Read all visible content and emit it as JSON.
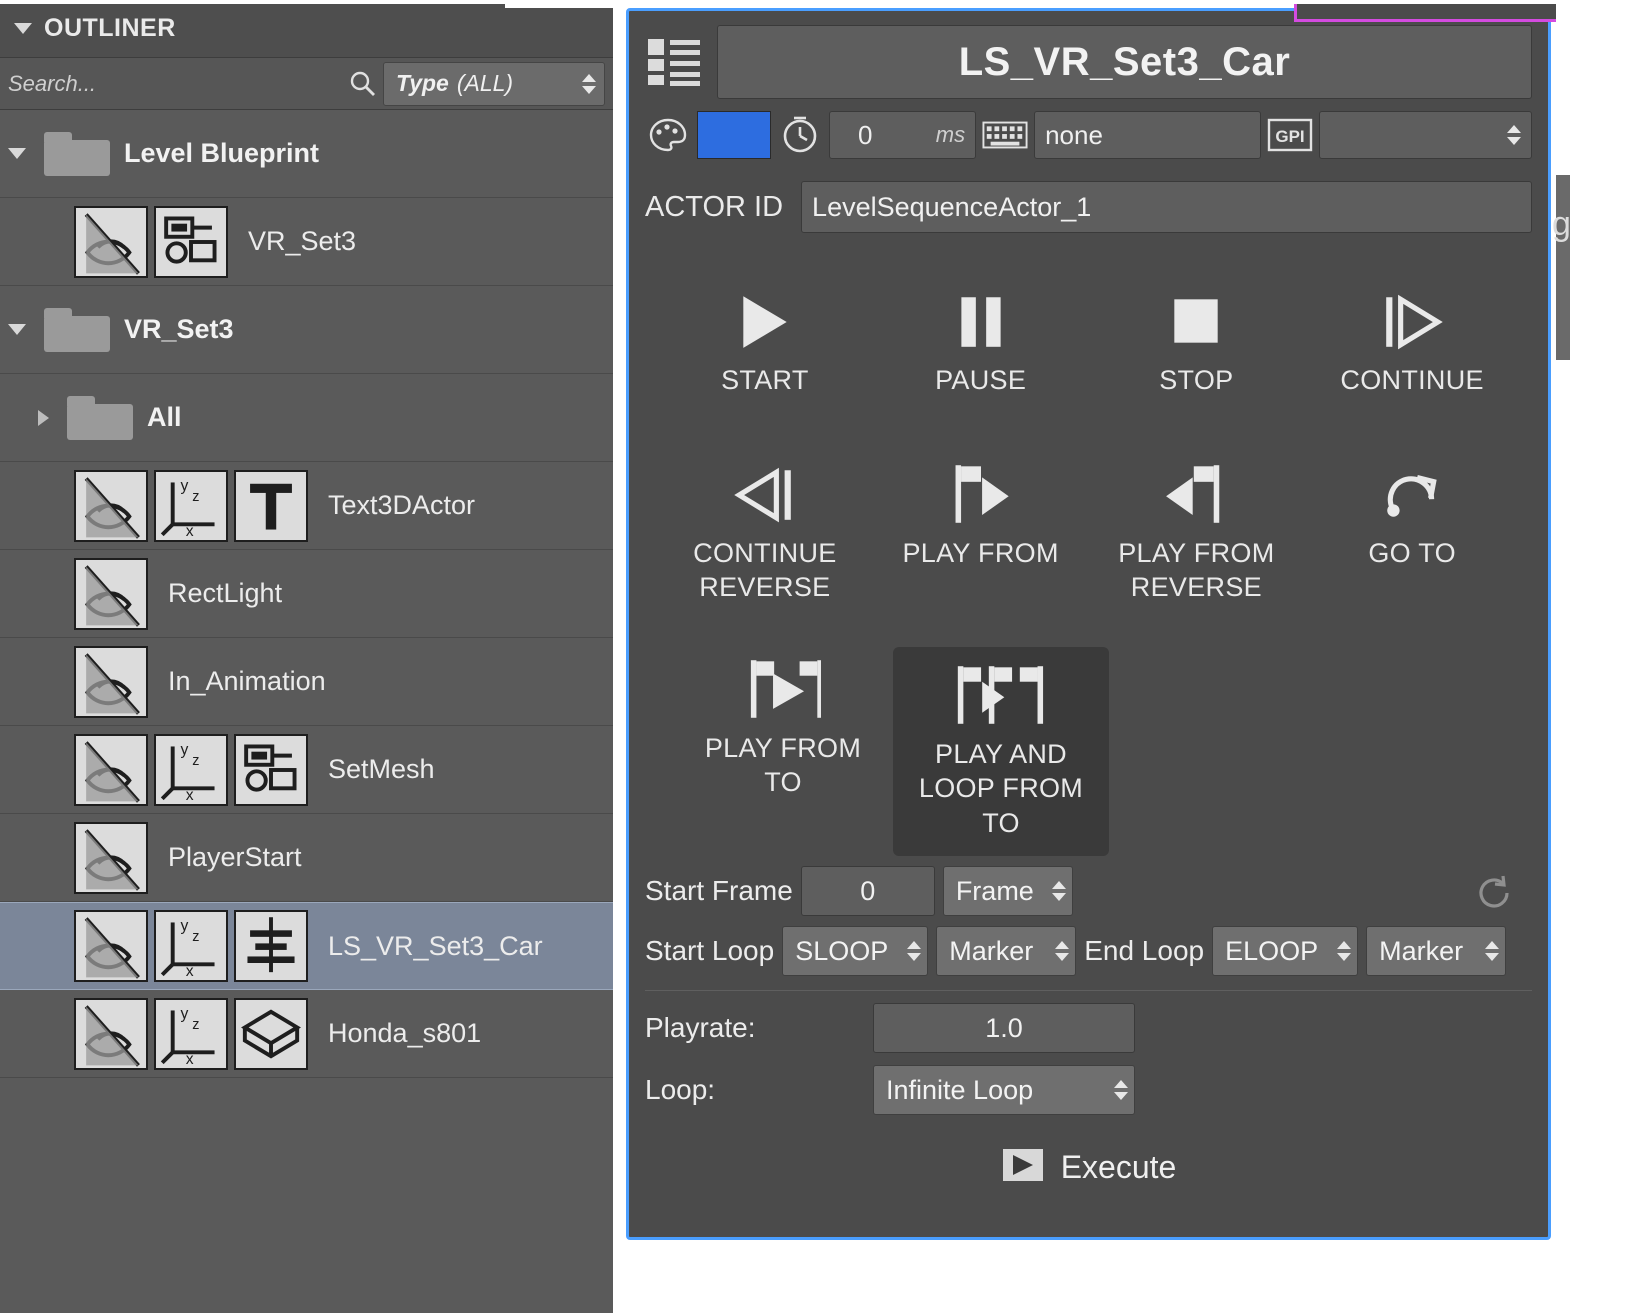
{
  "outliner": {
    "title": "OUTLINER",
    "search": {
      "placeholder": "Search...",
      "value": "",
      "icon": "search-icon"
    },
    "type_filter": {
      "label": "Type",
      "value": "(ALL)"
    },
    "tree": [
      {
        "label": "Level Blueprint",
        "kind": "folder",
        "indent": 0,
        "expanded": true,
        "icons": []
      },
      {
        "label": "VR_Set3",
        "kind": "actor",
        "indent": 1,
        "icons": [
          "eye-hidden-icon",
          "blueprint-icon"
        ]
      },
      {
        "label": "VR_Set3",
        "kind": "folder",
        "indent": 0,
        "expanded": true,
        "icons": []
      },
      {
        "label": "All",
        "kind": "folder",
        "indent": 1,
        "expanded": false,
        "icons": []
      },
      {
        "label": "Text3DActor",
        "kind": "actor",
        "indent": 1,
        "icons": [
          "eye-hidden-icon",
          "axis-icon",
          "text-icon"
        ]
      },
      {
        "label": "RectLight",
        "kind": "actor",
        "indent": 1,
        "icons": [
          "eye-hidden-icon"
        ]
      },
      {
        "label": "In_Animation",
        "kind": "actor",
        "indent": 1,
        "icons": [
          "eye-hidden-icon"
        ]
      },
      {
        "label": "SetMesh",
        "kind": "actor",
        "indent": 1,
        "icons": [
          "eye-hidden-icon",
          "axis-icon",
          "blueprint-icon"
        ]
      },
      {
        "label": "PlayerStart",
        "kind": "actor",
        "indent": 1,
        "icons": [
          "eye-hidden-icon"
        ]
      },
      {
        "label": "LS_VR_Set3_Car",
        "kind": "actor",
        "indent": 1,
        "selected": true,
        "icons": [
          "eye-hidden-icon",
          "axis-icon",
          "sequence-icon"
        ]
      },
      {
        "label": "Honda_s801",
        "kind": "actor",
        "indent": 1,
        "icons": [
          "eye-hidden-icon",
          "axis-icon",
          "mesh-icon"
        ]
      }
    ]
  },
  "tool_panel": {
    "title": "LS_VR_Set3_Car",
    "list_icon": "list-icon",
    "toolbar": {
      "palette_icon": "palette-icon",
      "color_swatch": "#2d6de0",
      "clock_icon": "clock-icon",
      "delay_value": "0",
      "delay_unit": "ms",
      "keyboard_icon": "keyboard-icon",
      "shortcut_value": "none",
      "gpi_icon": "gpi-icon",
      "gpi_value": ""
    },
    "actor_id": {
      "label": "ACTOR ID",
      "value": "LevelSequenceActor_1"
    },
    "transport_row1": [
      {
        "label": "START",
        "icon": "play-icon"
      },
      {
        "label": "PAUSE",
        "icon": "pause-icon"
      },
      {
        "label": "STOP",
        "icon": "stop-icon"
      },
      {
        "label": "CONTINUE",
        "icon": "continue-icon"
      }
    ],
    "transport_row2": [
      {
        "label": "CONTINUE REVERSE",
        "icon": "continue-reverse-icon"
      },
      {
        "label": "PLAY FROM",
        "icon": "play-from-icon"
      },
      {
        "label": "PLAY FROM REVERSE",
        "icon": "play-from-reverse-icon"
      },
      {
        "label": "GO TO",
        "icon": "go-to-icon"
      }
    ],
    "transport_row3": [
      {
        "label": "PLAY FROM TO",
        "icon": "play-from-to-icon",
        "active": false
      },
      {
        "label": "PLAY AND LOOP FROM TO",
        "icon": "play-and-loop-from-to-icon",
        "active": true
      }
    ],
    "reload_icon": "reload-icon",
    "start_frame": {
      "label": "Start Frame",
      "value": "0",
      "unit": "Frame"
    },
    "start_loop": {
      "label": "Start Loop",
      "value": "SLOOP",
      "type": "Marker"
    },
    "end_loop": {
      "label": "End Loop",
      "value": "ELOOP",
      "type": "Marker"
    },
    "playrate": {
      "label": "Playrate:",
      "value": "1.0"
    },
    "loop": {
      "label": "Loop:",
      "value": "Infinite Loop"
    },
    "execute": {
      "label": "Execute",
      "icon": "execute-icon"
    }
  },
  "side": {
    "letter": "g"
  }
}
